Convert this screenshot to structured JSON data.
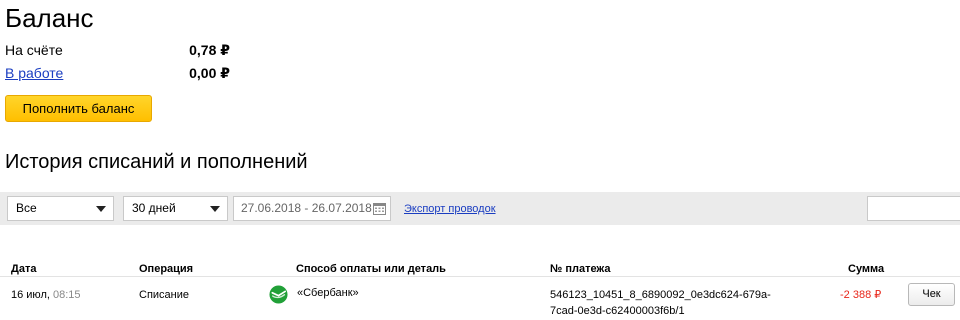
{
  "page": {
    "title": "Баланс"
  },
  "balance": {
    "on_account_label": "На счёте",
    "on_account_value": "0,78 ₽",
    "in_work_label": "В работе",
    "in_work_value": "0,00 ₽",
    "topup_button": "Пополнить баланс"
  },
  "history": {
    "title": "История списаний и пополнений",
    "filters": {
      "type_select": "Все",
      "period_select": "30 дней",
      "date_range": "27.06.2018 - 26.07.2018",
      "export_link": "Экспорт проводок"
    },
    "columns": {
      "date": "Дата",
      "operation": "Операция",
      "method": "Способ оплаты или деталь",
      "payment_no": "№ платежа",
      "amount": "Сумма"
    },
    "rows": [
      {
        "date": "16 июл,",
        "time": "08:15",
        "operation": "Списание",
        "method": "«Сбербанк»",
        "payment_no_line1": "546123_10451_8_6890092_0e3dc624-679a-",
        "payment_no_line2": "7cad-0e3d-c62400003f6b/1",
        "amount": "-2 388 ₽",
        "receipt_button": "Чек"
      }
    ]
  },
  "colors": {
    "accent_yellow": "#ffcc00",
    "link_blue": "#1a3dc1",
    "amount_red": "#e8271b",
    "sber_green": "#21a038"
  },
  "icons": {
    "date_picker": "calendar-icon",
    "payment_method": "sberbank-logo-icon",
    "dropdown": "chevron-down-icon"
  }
}
